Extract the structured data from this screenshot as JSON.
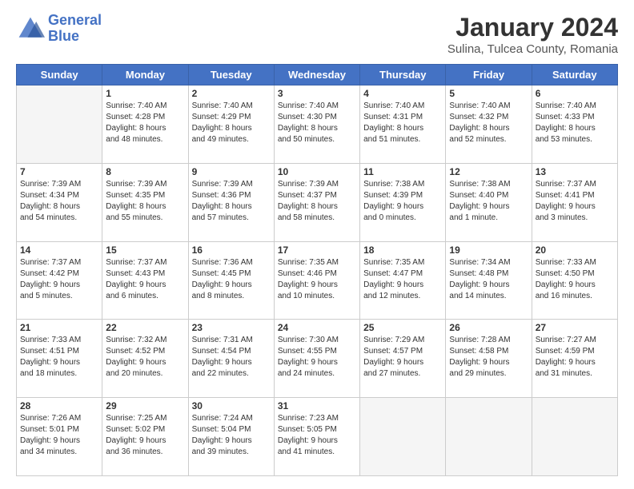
{
  "header": {
    "logo_line1": "General",
    "logo_line2": "Blue",
    "title": "January 2024",
    "subtitle": "Sulina, Tulcea County, Romania"
  },
  "weekdays": [
    "Sunday",
    "Monday",
    "Tuesday",
    "Wednesday",
    "Thursday",
    "Friday",
    "Saturday"
  ],
  "weeks": [
    [
      {
        "day": "",
        "content": ""
      },
      {
        "day": "1",
        "content": "Sunrise: 7:40 AM\nSunset: 4:28 PM\nDaylight: 8 hours\nand 48 minutes."
      },
      {
        "day": "2",
        "content": "Sunrise: 7:40 AM\nSunset: 4:29 PM\nDaylight: 8 hours\nand 49 minutes."
      },
      {
        "day": "3",
        "content": "Sunrise: 7:40 AM\nSunset: 4:30 PM\nDaylight: 8 hours\nand 50 minutes."
      },
      {
        "day": "4",
        "content": "Sunrise: 7:40 AM\nSunset: 4:31 PM\nDaylight: 8 hours\nand 51 minutes."
      },
      {
        "day": "5",
        "content": "Sunrise: 7:40 AM\nSunset: 4:32 PM\nDaylight: 8 hours\nand 52 minutes."
      },
      {
        "day": "6",
        "content": "Sunrise: 7:40 AM\nSunset: 4:33 PM\nDaylight: 8 hours\nand 53 minutes."
      }
    ],
    [
      {
        "day": "7",
        "content": "Sunrise: 7:39 AM\nSunset: 4:34 PM\nDaylight: 8 hours\nand 54 minutes."
      },
      {
        "day": "8",
        "content": "Sunrise: 7:39 AM\nSunset: 4:35 PM\nDaylight: 8 hours\nand 55 minutes."
      },
      {
        "day": "9",
        "content": "Sunrise: 7:39 AM\nSunset: 4:36 PM\nDaylight: 8 hours\nand 57 minutes."
      },
      {
        "day": "10",
        "content": "Sunrise: 7:39 AM\nSunset: 4:37 PM\nDaylight: 8 hours\nand 58 minutes."
      },
      {
        "day": "11",
        "content": "Sunrise: 7:38 AM\nSunset: 4:39 PM\nDaylight: 9 hours\nand 0 minutes."
      },
      {
        "day": "12",
        "content": "Sunrise: 7:38 AM\nSunset: 4:40 PM\nDaylight: 9 hours\nand 1 minute."
      },
      {
        "day": "13",
        "content": "Sunrise: 7:37 AM\nSunset: 4:41 PM\nDaylight: 9 hours\nand 3 minutes."
      }
    ],
    [
      {
        "day": "14",
        "content": "Sunrise: 7:37 AM\nSunset: 4:42 PM\nDaylight: 9 hours\nand 5 minutes."
      },
      {
        "day": "15",
        "content": "Sunrise: 7:37 AM\nSunset: 4:43 PM\nDaylight: 9 hours\nand 6 minutes."
      },
      {
        "day": "16",
        "content": "Sunrise: 7:36 AM\nSunset: 4:45 PM\nDaylight: 9 hours\nand 8 minutes."
      },
      {
        "day": "17",
        "content": "Sunrise: 7:35 AM\nSunset: 4:46 PM\nDaylight: 9 hours\nand 10 minutes."
      },
      {
        "day": "18",
        "content": "Sunrise: 7:35 AM\nSunset: 4:47 PM\nDaylight: 9 hours\nand 12 minutes."
      },
      {
        "day": "19",
        "content": "Sunrise: 7:34 AM\nSunset: 4:48 PM\nDaylight: 9 hours\nand 14 minutes."
      },
      {
        "day": "20",
        "content": "Sunrise: 7:33 AM\nSunset: 4:50 PM\nDaylight: 9 hours\nand 16 minutes."
      }
    ],
    [
      {
        "day": "21",
        "content": "Sunrise: 7:33 AM\nSunset: 4:51 PM\nDaylight: 9 hours\nand 18 minutes."
      },
      {
        "day": "22",
        "content": "Sunrise: 7:32 AM\nSunset: 4:52 PM\nDaylight: 9 hours\nand 20 minutes."
      },
      {
        "day": "23",
        "content": "Sunrise: 7:31 AM\nSunset: 4:54 PM\nDaylight: 9 hours\nand 22 minutes."
      },
      {
        "day": "24",
        "content": "Sunrise: 7:30 AM\nSunset: 4:55 PM\nDaylight: 9 hours\nand 24 minutes."
      },
      {
        "day": "25",
        "content": "Sunrise: 7:29 AM\nSunset: 4:57 PM\nDaylight: 9 hours\nand 27 minutes."
      },
      {
        "day": "26",
        "content": "Sunrise: 7:28 AM\nSunset: 4:58 PM\nDaylight: 9 hours\nand 29 minutes."
      },
      {
        "day": "27",
        "content": "Sunrise: 7:27 AM\nSunset: 4:59 PM\nDaylight: 9 hours\nand 31 minutes."
      }
    ],
    [
      {
        "day": "28",
        "content": "Sunrise: 7:26 AM\nSunset: 5:01 PM\nDaylight: 9 hours\nand 34 minutes."
      },
      {
        "day": "29",
        "content": "Sunrise: 7:25 AM\nSunset: 5:02 PM\nDaylight: 9 hours\nand 36 minutes."
      },
      {
        "day": "30",
        "content": "Sunrise: 7:24 AM\nSunset: 5:04 PM\nDaylight: 9 hours\nand 39 minutes."
      },
      {
        "day": "31",
        "content": "Sunrise: 7:23 AM\nSunset: 5:05 PM\nDaylight: 9 hours\nand 41 minutes."
      },
      {
        "day": "",
        "content": ""
      },
      {
        "day": "",
        "content": ""
      },
      {
        "day": "",
        "content": ""
      }
    ]
  ]
}
